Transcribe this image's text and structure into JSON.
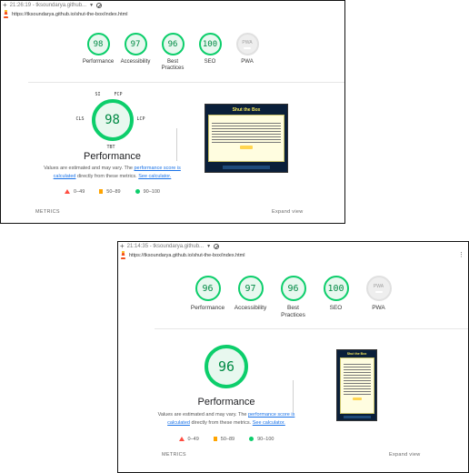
{
  "panels": [
    {
      "time_text": "21:26:19 - tksoundarya.github...",
      "url": "https://tksoundarya.github.io/shut-the-box/index.html",
      "gauges": [
        {
          "score": "98",
          "label": "Performance"
        },
        {
          "score": "97",
          "label": "Accessibility"
        },
        {
          "score": "96",
          "label": "Best Practices"
        },
        {
          "score": "100",
          "label": "SEO"
        },
        {
          "score": "PWA",
          "label": "PWA"
        }
      ],
      "metric_labels": {
        "si": "SI",
        "fcp": "FCP",
        "cls": "CLS",
        "lcp": "LCP",
        "tbt": "TBT"
      },
      "big_score": "98",
      "perf_title": "Performance",
      "desc": {
        "pre": "Values are estimated and may vary. The ",
        "link1": "performance score is calculated",
        "mid": " directly from these metrics. ",
        "link2": "See calculator."
      },
      "legend": {
        "poor": "0–49",
        "avg": "50–89",
        "good": "90–100"
      },
      "shot_title": "Shut the Box",
      "metrics_label": "METRICS",
      "expand_label": "Expand view"
    },
    {
      "time_text": "21:14:35 - tksoundarya.github...",
      "url": "https://tksoundarya.github.io/shut-the-box/index.html",
      "gauges": [
        {
          "score": "96",
          "label": "Performance"
        },
        {
          "score": "97",
          "label": "Accessibility"
        },
        {
          "score": "96",
          "label": "Best Practices"
        },
        {
          "score": "100",
          "label": "SEO"
        },
        {
          "score": "PWA",
          "label": "PWA"
        }
      ],
      "big_score": "96",
      "perf_title": "Performance",
      "desc": {
        "pre": "Values are estimated and may vary. The ",
        "link1": "performance score is calculated",
        "mid": " directly from these metrics. ",
        "link2": "See calculator."
      },
      "legend": {
        "poor": "0–49",
        "avg": "50–89",
        "good": "90–100"
      },
      "shot_title": "Shut the Box",
      "metrics_label": "METRICS",
      "expand_label": "Expand view"
    }
  ],
  "colors": {
    "good": "#0cce6b",
    "average": "#ffa400",
    "poor": "#ff4e42",
    "link": "#1a73e8"
  },
  "icons": [
    "plus-icon",
    "no-sign-icon",
    "lighthouse-icon",
    "kebab-menu-icon"
  ]
}
